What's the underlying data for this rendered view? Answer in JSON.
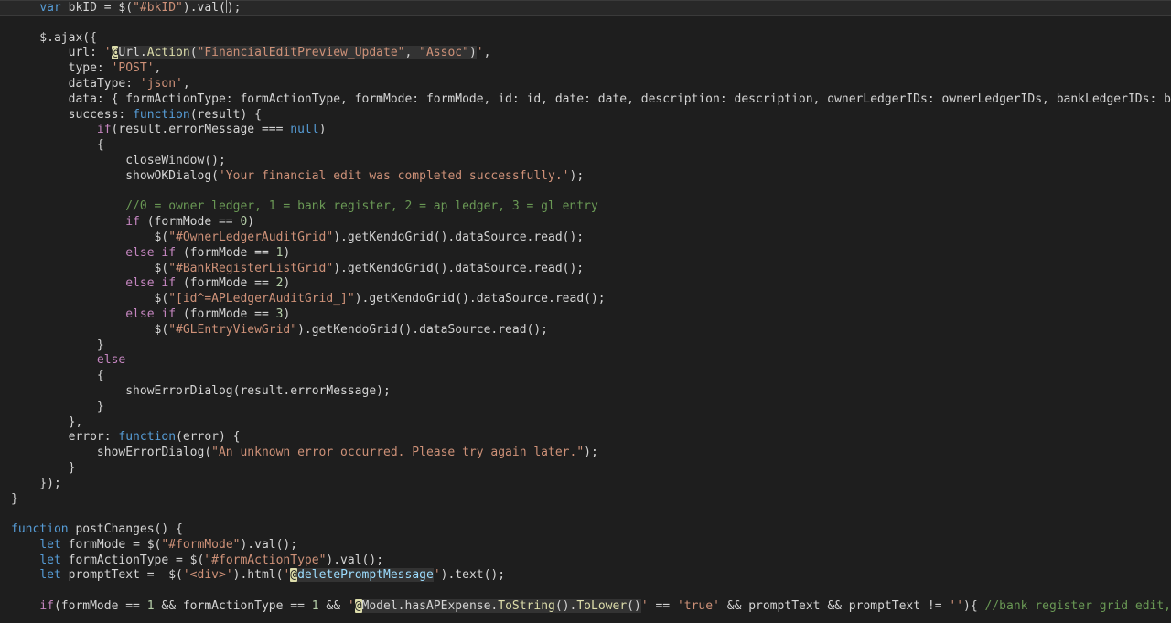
{
  "editor": {
    "cursor_line": 0,
    "colors": {
      "background": "#1e1e1e",
      "plain": "#d4d4d4",
      "keyword": "#569cd6",
      "control": "#c586c0",
      "string": "#ce9178",
      "number": "#b5cea8",
      "comment": "#6a9955",
      "function": "#dcdcaa",
      "variable": "#9cdcfe",
      "type": "#4ec9b0"
    },
    "lines": [
      [
        {
          "t": "    "
        },
        {
          "t": "var",
          "c": "kw"
        },
        {
          "t": " bkID = $("
        },
        {
          "t": "\"#bkID\"",
          "c": "str"
        },
        {
          "t": ").val("
        },
        {
          "cursor": true
        },
        {
          "t": ");"
        }
      ],
      [],
      [
        {
          "t": "    $.ajax({"
        }
      ],
      [
        {
          "t": "        url: "
        },
        {
          "t": "'",
          "c": "str"
        },
        {
          "t": "@",
          "c": "razor"
        },
        {
          "t": "Url",
          "c": "embed"
        },
        {
          "t": ".",
          "c": "embed"
        },
        {
          "t": "Action",
          "c": "fnembed"
        },
        {
          "t": "(",
          "c": "embed"
        },
        {
          "t": "\"FinancialEditPreview_Update\"",
          "c": "strembed"
        },
        {
          "t": ", ",
          "c": "embed"
        },
        {
          "t": "\"Assoc\"",
          "c": "strembed"
        },
        {
          "t": ")",
          "c": "embed"
        },
        {
          "t": "'",
          "c": "str"
        },
        {
          "t": ","
        }
      ],
      [
        {
          "t": "        type: "
        },
        {
          "t": "'POST'",
          "c": "str"
        },
        {
          "t": ","
        }
      ],
      [
        {
          "t": "        dataType: "
        },
        {
          "t": "'json'",
          "c": "str"
        },
        {
          "t": ","
        }
      ],
      [
        {
          "t": "        data: { formActionType: formActionType, formMode: formMode, id: id, date: date, description: description, ownerLedgerIDs: ownerLedgerIDs, bankLedgerIDs: bankLedgerIDs"
        }
      ],
      [
        {
          "t": "        success: "
        },
        {
          "t": "function",
          "c": "kw"
        },
        {
          "t": "(result) {"
        }
      ],
      [
        {
          "t": "            "
        },
        {
          "t": "if",
          "c": "ctl"
        },
        {
          "t": "(result.errorMessage === "
        },
        {
          "t": "null",
          "c": "kw"
        },
        {
          "t": ")"
        }
      ],
      [
        {
          "t": "            {"
        }
      ],
      [
        {
          "t": "                closeWindow();"
        }
      ],
      [
        {
          "t": "                showOKDialog("
        },
        {
          "t": "'Your financial edit was completed successfully.'",
          "c": "str"
        },
        {
          "t": ");"
        }
      ],
      [],
      [
        {
          "t": "                "
        },
        {
          "t": "//0 = owner ledger, 1 = bank register, 2 = ap ledger, 3 = gl entry",
          "c": "cmt"
        }
      ],
      [
        {
          "t": "                "
        },
        {
          "t": "if",
          "c": "ctl"
        },
        {
          "t": " (formMode == "
        },
        {
          "t": "0",
          "c": "num"
        },
        {
          "t": ")"
        }
      ],
      [
        {
          "t": "                    $("
        },
        {
          "t": "\"#OwnerLedgerAuditGrid\"",
          "c": "str"
        },
        {
          "t": ").getKendoGrid().dataSource.read();"
        }
      ],
      [
        {
          "t": "                "
        },
        {
          "t": "else if",
          "c": "ctl"
        },
        {
          "t": " (formMode == "
        },
        {
          "t": "1",
          "c": "num"
        },
        {
          "t": ")"
        }
      ],
      [
        {
          "t": "                    $("
        },
        {
          "t": "\"#BankRegisterListGrid\"",
          "c": "str"
        },
        {
          "t": ").getKendoGrid().dataSource.read();"
        }
      ],
      [
        {
          "t": "                "
        },
        {
          "t": "else if",
          "c": "ctl"
        },
        {
          "t": " (formMode == "
        },
        {
          "t": "2",
          "c": "num"
        },
        {
          "t": ")"
        }
      ],
      [
        {
          "t": "                    $("
        },
        {
          "t": "\"[id^=APLedgerAuditGrid_]\"",
          "c": "str"
        },
        {
          "t": ").getKendoGrid().dataSource.read();"
        }
      ],
      [
        {
          "t": "                "
        },
        {
          "t": "else if",
          "c": "ctl"
        },
        {
          "t": " (formMode == "
        },
        {
          "t": "3",
          "c": "num"
        },
        {
          "t": ")"
        }
      ],
      [
        {
          "t": "                    $("
        },
        {
          "t": "\"#GLEntryViewGrid\"",
          "c": "str"
        },
        {
          "t": ").getKendoGrid().dataSource.read();"
        }
      ],
      [
        {
          "t": "            }"
        }
      ],
      [
        {
          "t": "            "
        },
        {
          "t": "else",
          "c": "ctl"
        }
      ],
      [
        {
          "t": "            {"
        }
      ],
      [
        {
          "t": "                showErrorDialog(result.errorMessage);"
        }
      ],
      [
        {
          "t": "            }"
        }
      ],
      [
        {
          "t": "        },"
        }
      ],
      [
        {
          "t": "        error: "
        },
        {
          "t": "function",
          "c": "kw"
        },
        {
          "t": "(error) {"
        }
      ],
      [
        {
          "t": "            showErrorDialog("
        },
        {
          "t": "\"An unknown error occurred. Please try again later.\"",
          "c": "str"
        },
        {
          "t": ");"
        }
      ],
      [
        {
          "t": "        }"
        }
      ],
      [
        {
          "t": "    });"
        }
      ],
      [
        {
          "t": "}"
        }
      ],
      [],
      [
        {
          "t": "function",
          "c": "kw"
        },
        {
          "t": " postChanges() {"
        }
      ],
      [
        {
          "t": "    "
        },
        {
          "t": "let",
          "c": "kw"
        },
        {
          "t": " formMode = $("
        },
        {
          "t": "\"#formMode\"",
          "c": "str"
        },
        {
          "t": ").val();"
        }
      ],
      [
        {
          "t": "    "
        },
        {
          "t": "let",
          "c": "kw"
        },
        {
          "t": " formActionType = $("
        },
        {
          "t": "\"#formActionType\"",
          "c": "str"
        },
        {
          "t": ").val();"
        }
      ],
      [
        {
          "t": "    "
        },
        {
          "t": "let",
          "c": "kw"
        },
        {
          "t": " promptText =  $("
        },
        {
          "t": "'<div>'",
          "c": "str"
        },
        {
          "t": ").html("
        },
        {
          "t": "'",
          "c": "str"
        },
        {
          "t": "@",
          "c": "razor"
        },
        {
          "t": "deletePromptMessage",
          "c": "varembed"
        },
        {
          "t": "'",
          "c": "str"
        },
        {
          "t": ").text();"
        }
      ],
      [],
      [
        {
          "t": "    "
        },
        {
          "t": "if",
          "c": "ctl"
        },
        {
          "t": "(formMode == "
        },
        {
          "t": "1",
          "c": "num"
        },
        {
          "t": " && formActionType == "
        },
        {
          "t": "1",
          "c": "num"
        },
        {
          "t": " && "
        },
        {
          "t": "'",
          "c": "str"
        },
        {
          "t": "@",
          "c": "razor"
        },
        {
          "t": "Model",
          "c": "embed"
        },
        {
          "t": ".hasAPExpense.",
          "c": "embed"
        },
        {
          "t": "ToString",
          "c": "fnembed"
        },
        {
          "t": "().",
          "c": "embed"
        },
        {
          "t": "ToLower",
          "c": "fnembed"
        },
        {
          "t": "()",
          "c": "embed"
        },
        {
          "t": "'",
          "c": "str"
        },
        {
          "t": " == "
        },
        {
          "t": "'true'",
          "c": "str"
        },
        {
          "t": " && promptText && promptText != "
        },
        {
          "t": "''",
          "c": "str"
        },
        {
          "t": "){ "
        },
        {
          "t": "//bank register grid edit, deleting",
          "c": "cmt"
        }
      ]
    ]
  }
}
